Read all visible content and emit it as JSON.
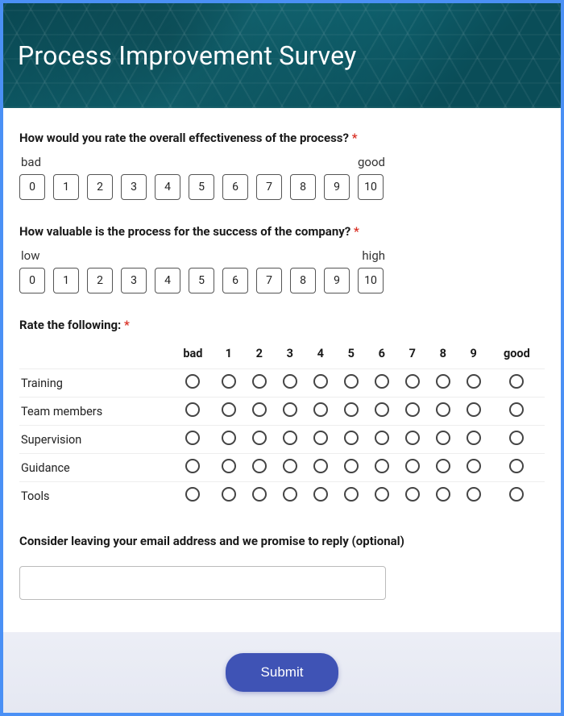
{
  "header": {
    "title": "Process Improvement Survey"
  },
  "required_marker": "*",
  "q1": {
    "title": "How would you rate the overall effectiveness of the process?",
    "low_label": "bad",
    "high_label": "good",
    "options": [
      "0",
      "1",
      "2",
      "3",
      "4",
      "5",
      "6",
      "7",
      "8",
      "9",
      "10"
    ]
  },
  "q2": {
    "title": "How valuable is the process for the success of the company?",
    "low_label": "low",
    "high_label": "high",
    "options": [
      "0",
      "1",
      "2",
      "3",
      "4",
      "5",
      "6",
      "7",
      "8",
      "9",
      "10"
    ]
  },
  "q3": {
    "title": "Rate the following:",
    "col_headers": [
      "bad",
      "1",
      "2",
      "3",
      "4",
      "5",
      "6",
      "7",
      "8",
      "9",
      "good"
    ],
    "rows": [
      "Training",
      "Team members",
      "Supervision",
      "Guidance",
      "Tools"
    ]
  },
  "q4": {
    "title": "Consider leaving your email address and we promise to reply (optional)",
    "placeholder": ""
  },
  "submit_label": "Submit"
}
